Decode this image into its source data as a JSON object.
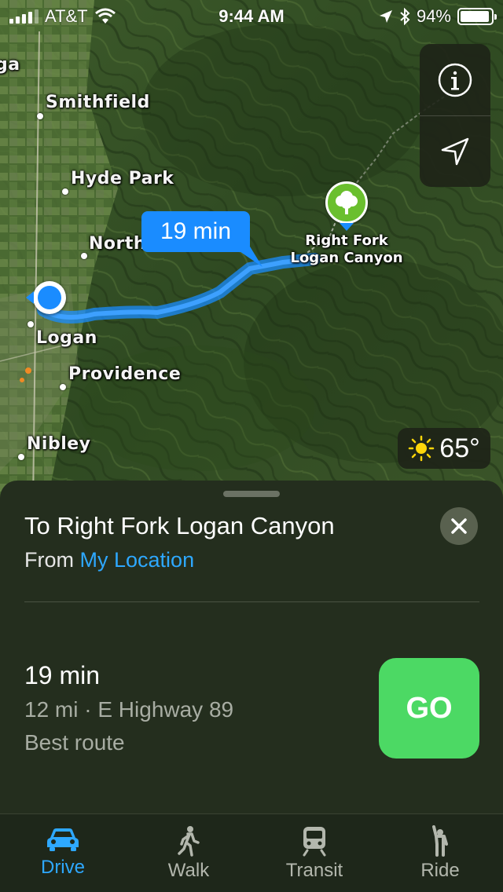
{
  "status_bar": {
    "carrier": "AT&T",
    "time": "9:44 AM",
    "battery_percent": "94%",
    "battery_level": 0.94
  },
  "map": {
    "towns": [
      {
        "name": "Smithfield"
      },
      {
        "name": "Hyde Park"
      },
      {
        "name": "North"
      },
      {
        "name": "Logan"
      },
      {
        "name": "Providence"
      },
      {
        "name": "Nibley"
      }
    ],
    "edge_label": "ga",
    "route_time_label": "19 min",
    "destination_label_line1": "Right Fork",
    "destination_label_line2": "Logan Canyon",
    "destination_icon": "tree-icon",
    "weather": {
      "icon": "sun-icon",
      "temperature": "65°"
    },
    "controls": [
      {
        "icon": "info-icon"
      },
      {
        "icon": "location-arrow-icon"
      }
    ],
    "colors": {
      "route": "#1a8cff",
      "current_location": "#1a8cff",
      "poi": "#6abf2e"
    }
  },
  "sheet": {
    "title": "To Right Fork Logan Canyon",
    "from_prefix": "From",
    "from_location": "My Location",
    "route": {
      "time": "19 min",
      "detail": "12 mi · E Highway 89",
      "note": "Best route"
    },
    "go_label": "GO",
    "colors": {
      "go": "#4cd964",
      "link": "#2ea8ff"
    }
  },
  "tabs": [
    {
      "label": "Drive",
      "icon": "car-icon",
      "active": true
    },
    {
      "label": "Walk",
      "icon": "walk-icon",
      "active": false
    },
    {
      "label": "Transit",
      "icon": "train-icon",
      "active": false
    },
    {
      "label": "Ride",
      "icon": "ride-icon",
      "active": false
    }
  ]
}
